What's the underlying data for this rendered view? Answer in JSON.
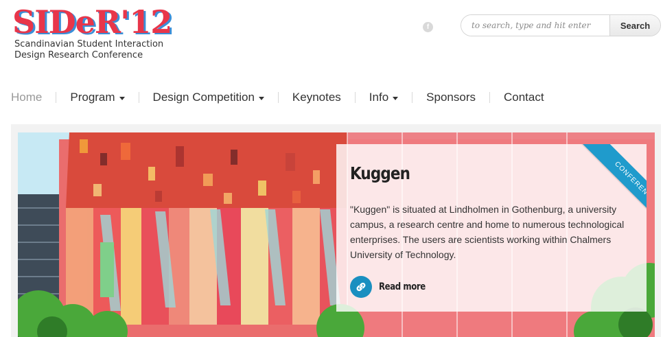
{
  "header": {
    "logo_text": "SIDeR'12",
    "logo_subtitle_line1": "Scandinavian Student Interaction",
    "logo_subtitle_line2": "Design Research Conference",
    "facebook_icon": "facebook-icon",
    "search": {
      "placeholder": "to search, type and hit enter",
      "value": "",
      "button_label": "Search"
    }
  },
  "nav": {
    "items": [
      {
        "label": "Home",
        "dropdown": false
      },
      {
        "label": "Program",
        "dropdown": true
      },
      {
        "label": "Design Competition",
        "dropdown": true
      },
      {
        "label": "Keynotes",
        "dropdown": false
      },
      {
        "label": "Info",
        "dropdown": true
      },
      {
        "label": "Sponsors",
        "dropdown": false
      },
      {
        "label": "Contact",
        "dropdown": false
      }
    ]
  },
  "hero": {
    "title": "Kuggen",
    "description": "\"Kuggen\" is situated at Lindholmen in Gothenburg, a university campus, a research centre and home to numerous technological enterprises. The users are scientists working within Chalmers University of Technology.",
    "read_more_label": "Read more",
    "ribbon_label": "CONFERENCE",
    "link_icon": "link-icon"
  },
  "colors": {
    "logo_red": "#e8364a",
    "logo_blue": "#3a8fd8",
    "accent_blue": "#1f9bcc"
  }
}
